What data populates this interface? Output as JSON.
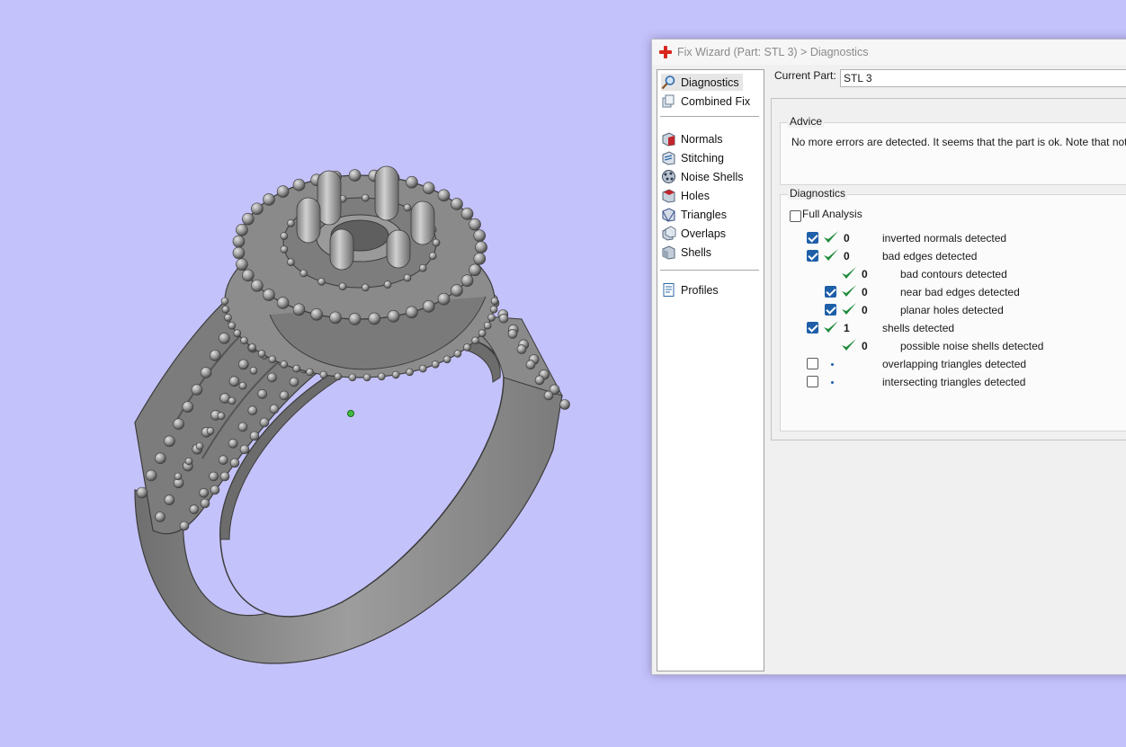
{
  "window": {
    "title": "Fix Wizard (Part: STL 3) > Diagnostics",
    "accent": "#d7261e"
  },
  "nav": {
    "items": [
      {
        "label": "Diagnostics",
        "icon": "magnifier-icon",
        "selected": true
      },
      {
        "label": "Combined Fix",
        "icon": "combined-fix-icon"
      },
      {
        "label": "Normals",
        "icon": "normals-icon"
      },
      {
        "label": "Stitching",
        "icon": "stitching-icon"
      },
      {
        "label": "Noise Shells",
        "icon": "noise-shells-icon"
      },
      {
        "label": "Holes",
        "icon": "holes-icon"
      },
      {
        "label": "Triangles",
        "icon": "triangles-icon"
      },
      {
        "label": "Overlaps",
        "icon": "overlaps-icon"
      },
      {
        "label": "Shells",
        "icon": "shells-icon"
      },
      {
        "label": "Profiles",
        "icon": "profiles-icon"
      }
    ]
  },
  "current_part": {
    "label": "Current Part:",
    "value": "STL 3"
  },
  "advice": {
    "title": "Advice",
    "text": "No more errors are detected. It seems that the part is ok. Note that not all pa"
  },
  "diagnostics": {
    "title": "Diagnostics",
    "full_analysis_label": "Full Analysis",
    "full_analysis_checked": false,
    "rows": [
      {
        "checkbox": true,
        "checked": true,
        "status": "ok",
        "count": "0",
        "desc": "inverted normals detected"
      },
      {
        "checkbox": true,
        "checked": true,
        "status": "ok",
        "count": "0",
        "desc": "bad edges detected"
      },
      {
        "checkbox": false,
        "checked": false,
        "status": "ok",
        "count": "0",
        "desc": "bad contours detected"
      },
      {
        "checkbox": true,
        "checked": true,
        "status": "ok",
        "count": "0",
        "desc": "near bad edges detected"
      },
      {
        "checkbox": true,
        "checked": true,
        "status": "ok",
        "count": "0",
        "desc": "planar holes detected"
      },
      {
        "checkbox": true,
        "checked": true,
        "status": "ok",
        "count": "1",
        "desc": "shells detected"
      },
      {
        "checkbox": false,
        "checked": false,
        "status": "ok",
        "count": "0",
        "desc": "possible noise shells detected"
      },
      {
        "checkbox": true,
        "checked": false,
        "status": "pending",
        "count": "",
        "desc": "overlapping triangles detected"
      },
      {
        "checkbox": true,
        "checked": false,
        "status": "pending",
        "count": "",
        "desc": "intersecting triangles detected"
      }
    ]
  },
  "viewport": {
    "background": "#c4c2fa",
    "model_color": "#8f8f8f",
    "pivot_color": "#3fbf3f"
  }
}
